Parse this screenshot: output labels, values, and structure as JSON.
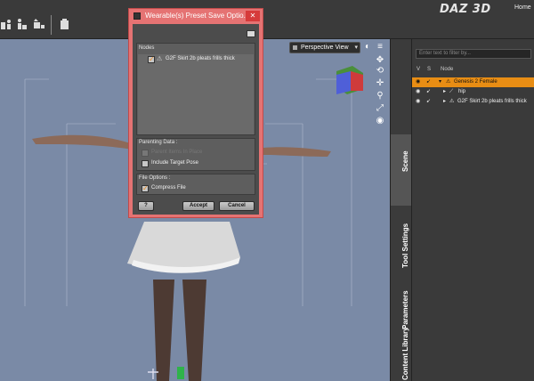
{
  "app": {
    "logo": "DAZ 3D",
    "home_label": "Home"
  },
  "toolbar": {
    "icons": [
      "scene-icon",
      "figure-icon",
      "content-icon",
      "save-icon"
    ]
  },
  "viewport": {
    "camera_label": "Perspective View",
    "background_color": "#7a8aa6"
  },
  "side_tabs": [
    "Scene",
    "Tool Settings",
    "Parameters",
    "Content Library"
  ],
  "scene_panel": {
    "filter_placeholder": "Enter text to filter by...",
    "columns": {
      "v": "V",
      "s": "S",
      "node": "Node"
    },
    "rows": [
      {
        "label": "Genesis 2 Female",
        "selected": true
      },
      {
        "label": "hip",
        "selected": false
      },
      {
        "label": "G2F Skirt 2b pleats frills thick",
        "selected": false
      }
    ],
    "selection_color": "#e88d14"
  },
  "dialog": {
    "title": "Wearable(s) Preset Save Optio...",
    "close_label": "✕",
    "nodes_label": "Nodes",
    "nodes": [
      {
        "label": "G2F Skirt 2b pleats frills thick",
        "checked": true
      }
    ],
    "parenting_label": "Parenting Data :",
    "parenting_options": [
      {
        "label": "Parent Items In Place",
        "checked": false,
        "disabled": true
      },
      {
        "label": "Include Target Pose",
        "checked": false,
        "disabled": false
      }
    ],
    "file_options_label": "File Options :",
    "file_options": [
      {
        "label": "Compress File",
        "checked": true
      }
    ],
    "help_label": "?",
    "accept_label": "Accept",
    "cancel_label": "Cancel",
    "accent_color": "#e57373"
  }
}
